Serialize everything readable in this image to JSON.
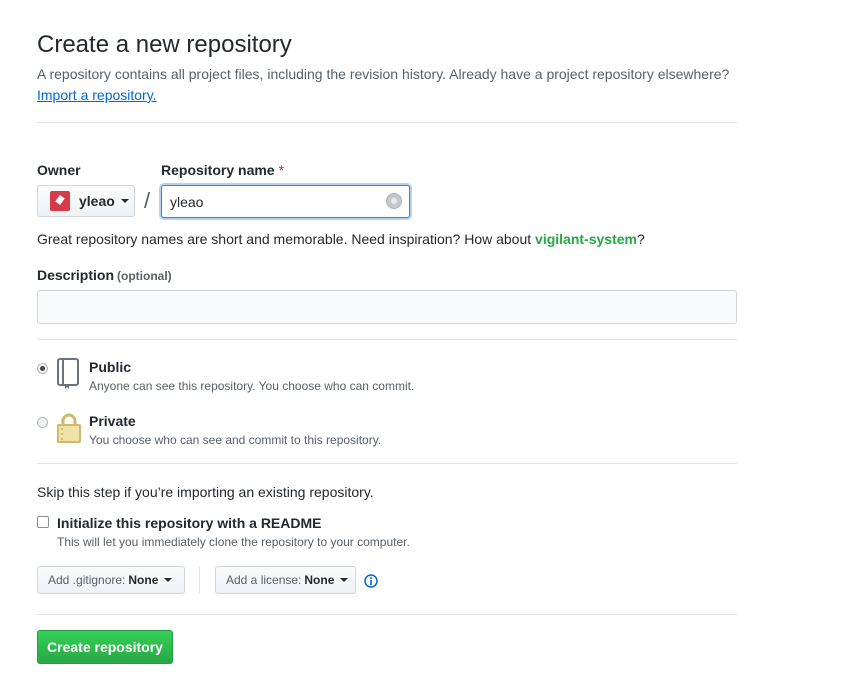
{
  "page": {
    "title": "Create a new repository",
    "subtitle": "A repository contains all project files, including the revision history. Already have a project repository elsewhere?",
    "import_link": "Import a repository."
  },
  "owner": {
    "label": "Owner",
    "name": "yleao",
    "avatar_color": "#d73a49",
    "avatar_icon": "user-avatar-icon"
  },
  "repo": {
    "label": "Repository name",
    "required_mark": "*",
    "value": "yleao",
    "separator": "/",
    "status_icon": "loading-spinner-icon"
  },
  "hint": {
    "text": "Great repository names are short and memorable. Need inspiration? How about ",
    "suggestion": "vigilant-system",
    "suffix": "?"
  },
  "description": {
    "label": "Description",
    "optional": "(optional)",
    "value": ""
  },
  "visibility": {
    "selected": "public",
    "public": {
      "title": "Public",
      "desc": "Anyone can see this repository. You choose who can commit.",
      "icon": "repo-book-icon"
    },
    "private": {
      "title": "Private",
      "desc": "You choose who can see and commit to this repository.",
      "icon": "lock-icon"
    }
  },
  "init": {
    "skip_text": "Skip this step if you’re importing an existing repository.",
    "readme_label": "Initialize this repository with a README",
    "readme_desc": "This will let you immediately clone the repository to your computer.",
    "readme_checked": false
  },
  "gitignore": {
    "prefix": "Add .gitignore:",
    "value": "None"
  },
  "license": {
    "prefix": "Add a license:",
    "value": "None",
    "info_icon": "info-icon"
  },
  "submit": {
    "label": "Create repository",
    "color": "#28a745"
  }
}
